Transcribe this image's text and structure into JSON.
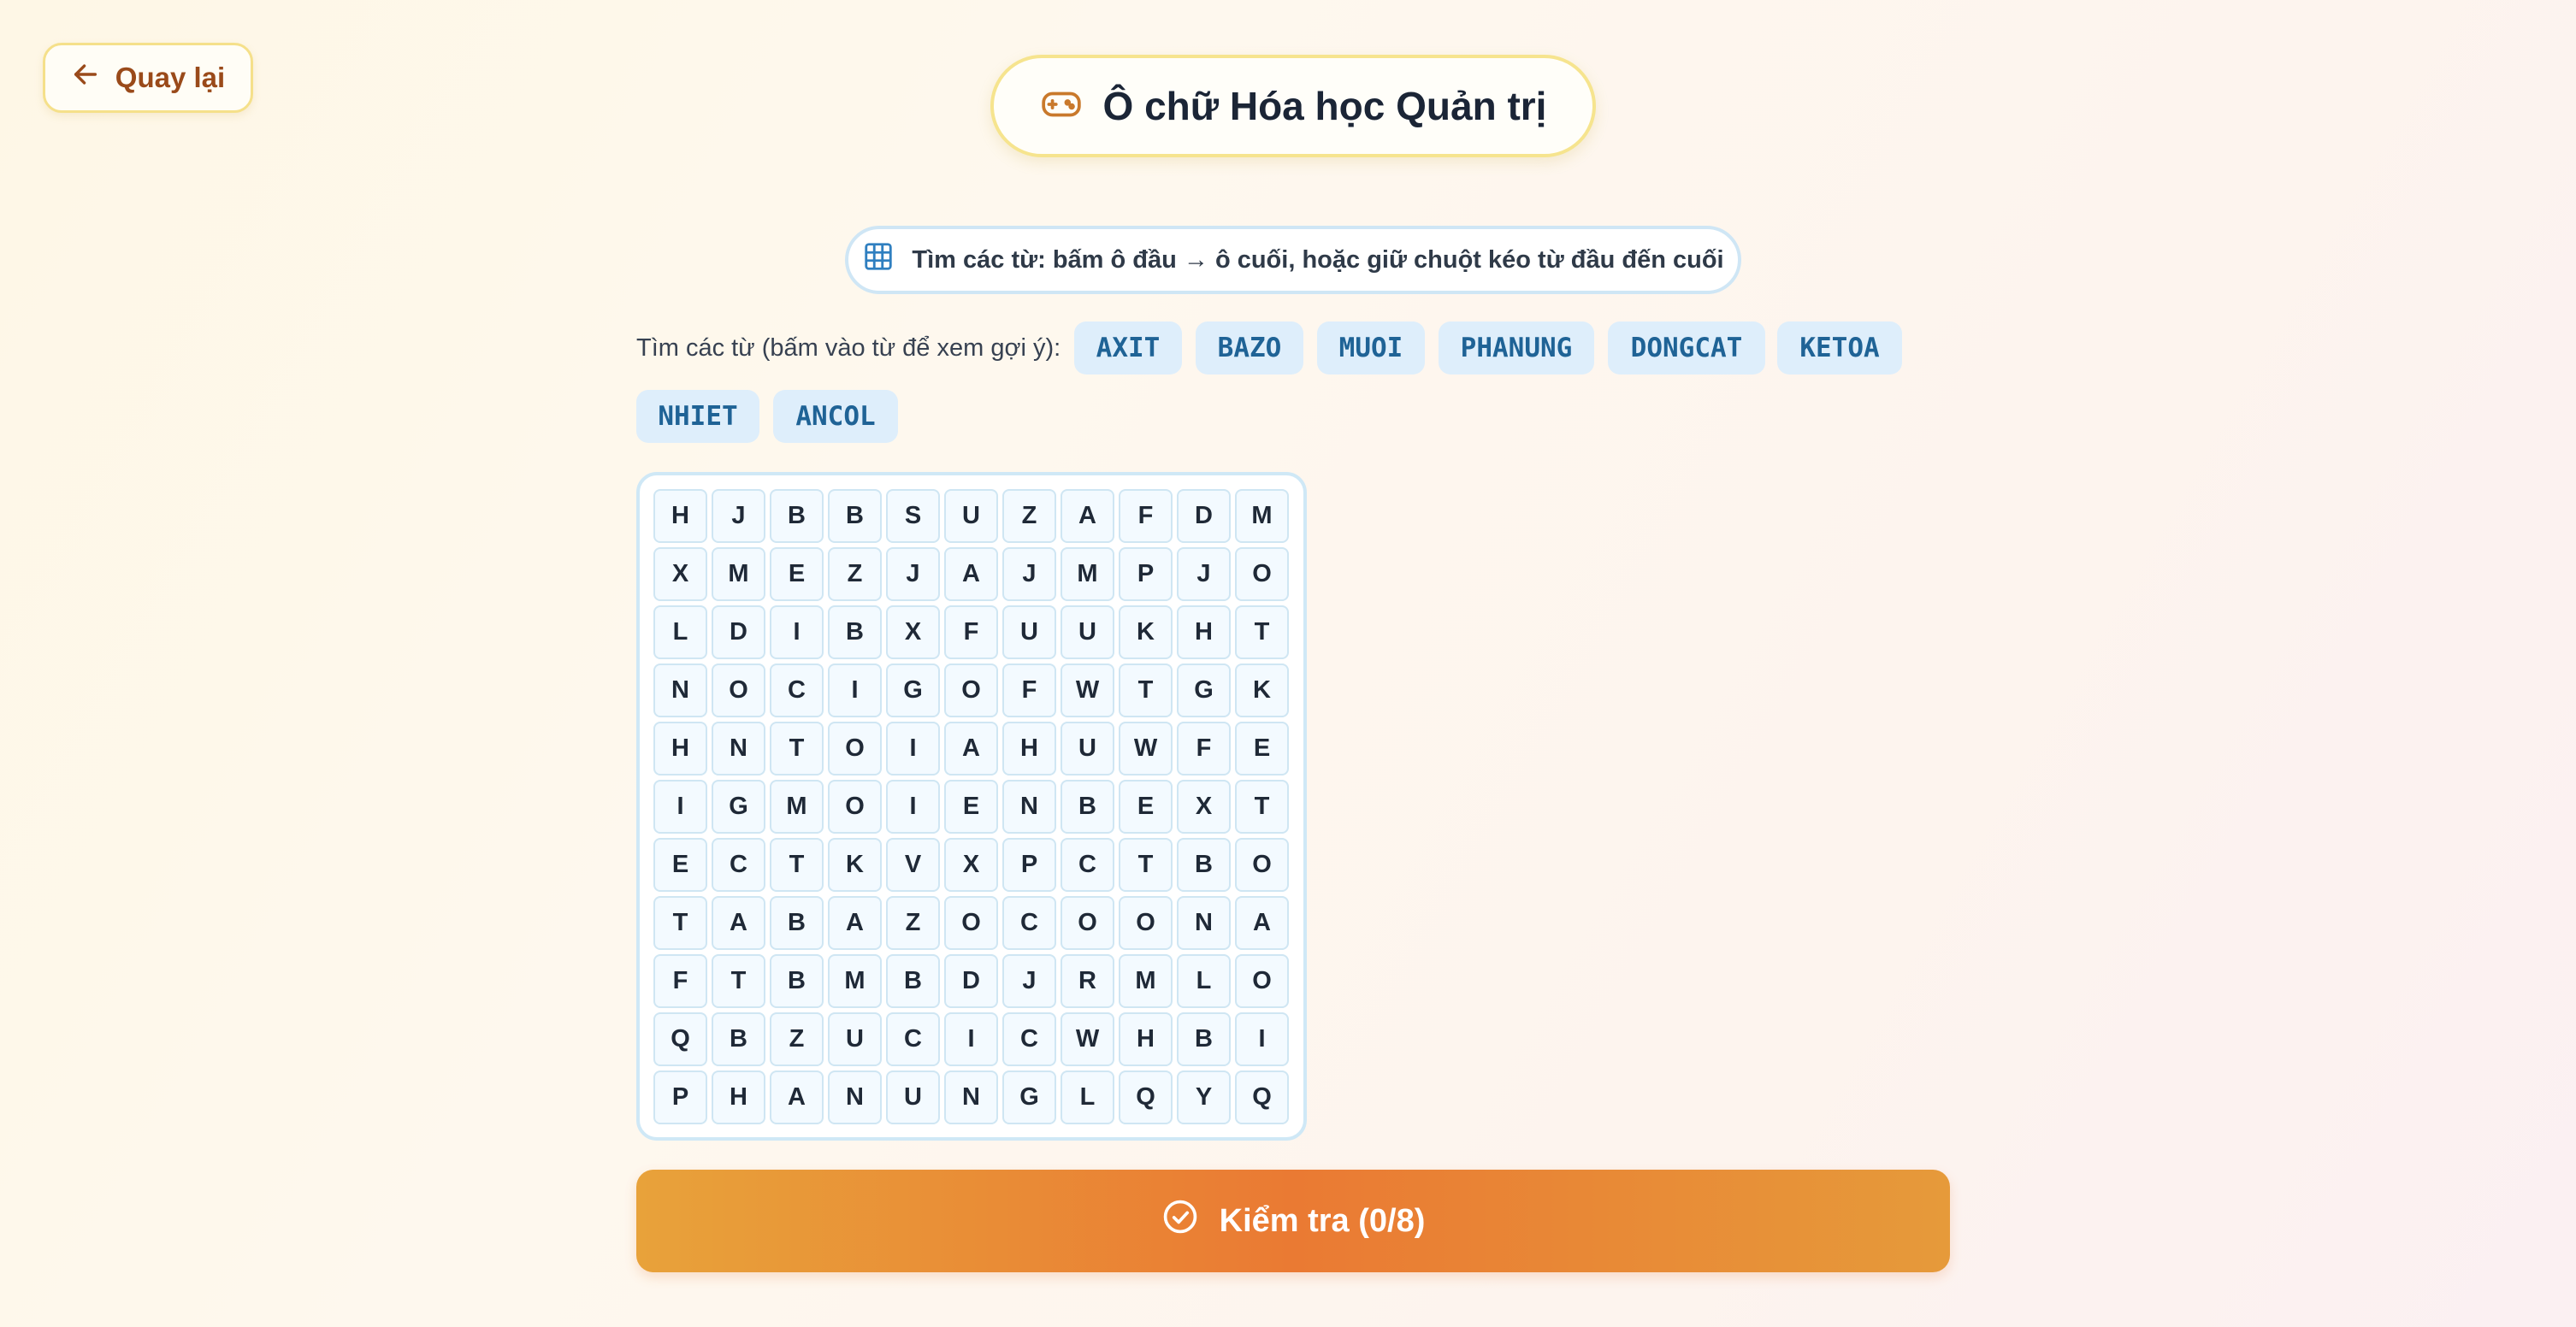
{
  "back_label": "Quay lại",
  "title": "Ô chữ Hóa học Quản trị",
  "instruction": "Tìm các từ: bấm ô đầu → ô cuối, hoặc giữ chuột kéo từ đầu đến cuối",
  "words_label": "Tìm các từ (bấm vào từ để xem gợi ý):",
  "words": [
    "AXIT",
    "BAZO",
    "MUOI",
    "PHANUNG",
    "DONGCAT",
    "KETOA",
    "NHIET",
    "ANCOL"
  ],
  "grid": [
    [
      "H",
      "J",
      "B",
      "B",
      "S",
      "U",
      "Z",
      "A",
      "F",
      "D",
      "M"
    ],
    [
      "X",
      "M",
      "E",
      "Z",
      "J",
      "A",
      "J",
      "M",
      "P",
      "J",
      "O"
    ],
    [
      "L",
      "D",
      "I",
      "B",
      "X",
      "F",
      "U",
      "U",
      "K",
      "H",
      "T"
    ],
    [
      "N",
      "O",
      "C",
      "I",
      "G",
      "O",
      "F",
      "W",
      "T",
      "G",
      "K"
    ],
    [
      "H",
      "N",
      "T",
      "O",
      "I",
      "A",
      "H",
      "U",
      "W",
      "F",
      "E"
    ],
    [
      "I",
      "G",
      "M",
      "O",
      "I",
      "E",
      "N",
      "B",
      "E",
      "X",
      "T"
    ],
    [
      "E",
      "C",
      "T",
      "K",
      "V",
      "X",
      "P",
      "C",
      "T",
      "B",
      "O"
    ],
    [
      "T",
      "A",
      "B",
      "A",
      "Z",
      "O",
      "C",
      "O",
      "O",
      "N",
      "A"
    ],
    [
      "F",
      "T",
      "B",
      "M",
      "B",
      "D",
      "J",
      "R",
      "M",
      "L",
      "O"
    ],
    [
      "Q",
      "B",
      "Z",
      "U",
      "C",
      "I",
      "C",
      "W",
      "H",
      "B",
      "I"
    ],
    [
      "P",
      "H",
      "A",
      "N",
      "U",
      "N",
      "G",
      "L",
      "Q",
      "Y",
      "Q"
    ]
  ],
  "check_label": "Kiểm tra (0/8)",
  "icons": {
    "back": "arrow-left-icon",
    "title": "gamepad-icon",
    "instruction": "grid-icon",
    "check": "check-circle-icon"
  },
  "colors": {
    "accent": "#ea7a33",
    "chip_bg": "#deeefb",
    "chip_text": "#1f6396",
    "title_border": "#f6e48e"
  }
}
